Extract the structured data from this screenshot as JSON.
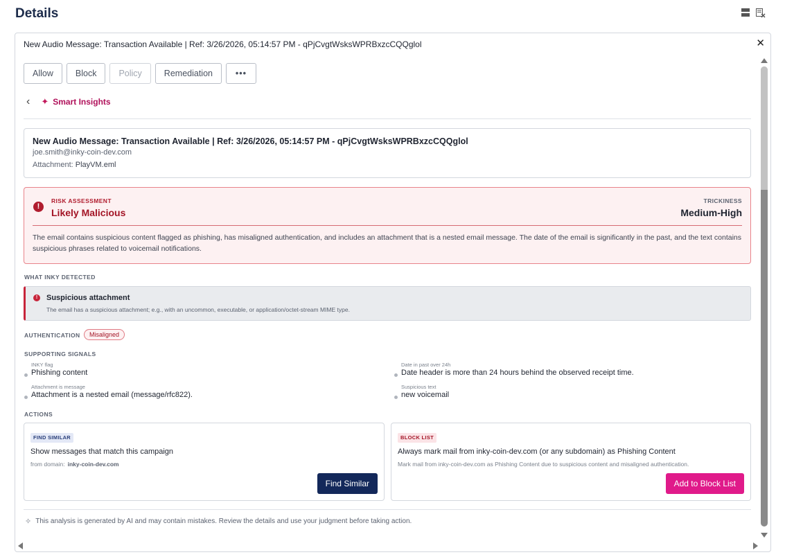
{
  "page": {
    "title": "Details"
  },
  "panel": {
    "title": "New Audio Message: Transaction Available | Ref: 3/26/2026, 05:14:57 PM - qPjCvgtWsksWPRBxzcCQQglol"
  },
  "toolbar": {
    "allow": "Allow",
    "block": "Block",
    "policy": "Policy",
    "remediation": "Remediation",
    "more": "•••"
  },
  "insights": {
    "label": "Smart Insights"
  },
  "message": {
    "subject": "New Audio Message: Transaction Available | Ref: 3/26/2026, 05:14:57 PM - qPjCvgtWsksWPRBxzcCQQglol",
    "from": "joe.smith@inky-coin-dev.com",
    "attachment_label": "Attachment:",
    "attachment_value": "PlayVM.eml"
  },
  "risk": {
    "label": "RISK ASSESSMENT",
    "value": "Likely Malicious",
    "trickiness_label": "TRICKINESS",
    "trickiness_value": "Medium-High",
    "summary": "The email contains suspicious content flagged as phishing, has misaligned authentication, and includes an attachment that is a nested email message. The date of the email is significantly in the past, and the text contains suspicious phrases related to voicemail notifications."
  },
  "detected": {
    "label": "WHAT INKY DETECTED",
    "title": "Suspicious attachment",
    "description": "The email has a suspicious attachment; e.g., with an uncommon, executable, or application/octet-stream MIME type."
  },
  "authentication": {
    "label": "AUTHENTICATION",
    "status": "Misaligned"
  },
  "signals": {
    "label": "SUPPORTING SIGNALS",
    "items": [
      {
        "label": "INKY flag",
        "value": "Phishing content"
      },
      {
        "label": "Date in past over 24h",
        "value": "Date header is more than 24 hours behind the observed receipt time."
      },
      {
        "label": "Attachment is message",
        "value": "Attachment is a nested email (message/rfc822)."
      },
      {
        "label": "Suspicious text",
        "value": "new voicemail"
      }
    ]
  },
  "actions": {
    "label": "ACTIONS",
    "find_similar": {
      "tag": "FIND SIMILAR",
      "title": "Show messages that match this campaign",
      "sub_label": "from domain:",
      "sub_value": "inky-coin-dev.com",
      "button": "Find Similar"
    },
    "block_list": {
      "tag": "BLOCK LIST",
      "title": "Always mark mail from inky-coin-dev.com (or any subdomain) as Phishing Content",
      "sub": "Mark mail from inky-coin-dev.com as Phishing Content due to suspicious content and misaligned authentication.",
      "button": "Add to Block List"
    }
  },
  "footer": {
    "note": "This analysis is generated by AI and may contain mistakes. Review the details and use your judgment before taking action."
  },
  "colors": {
    "brand_navy": "#13285a",
    "brand_pink": "#e01a8a",
    "danger": "#a31526"
  }
}
